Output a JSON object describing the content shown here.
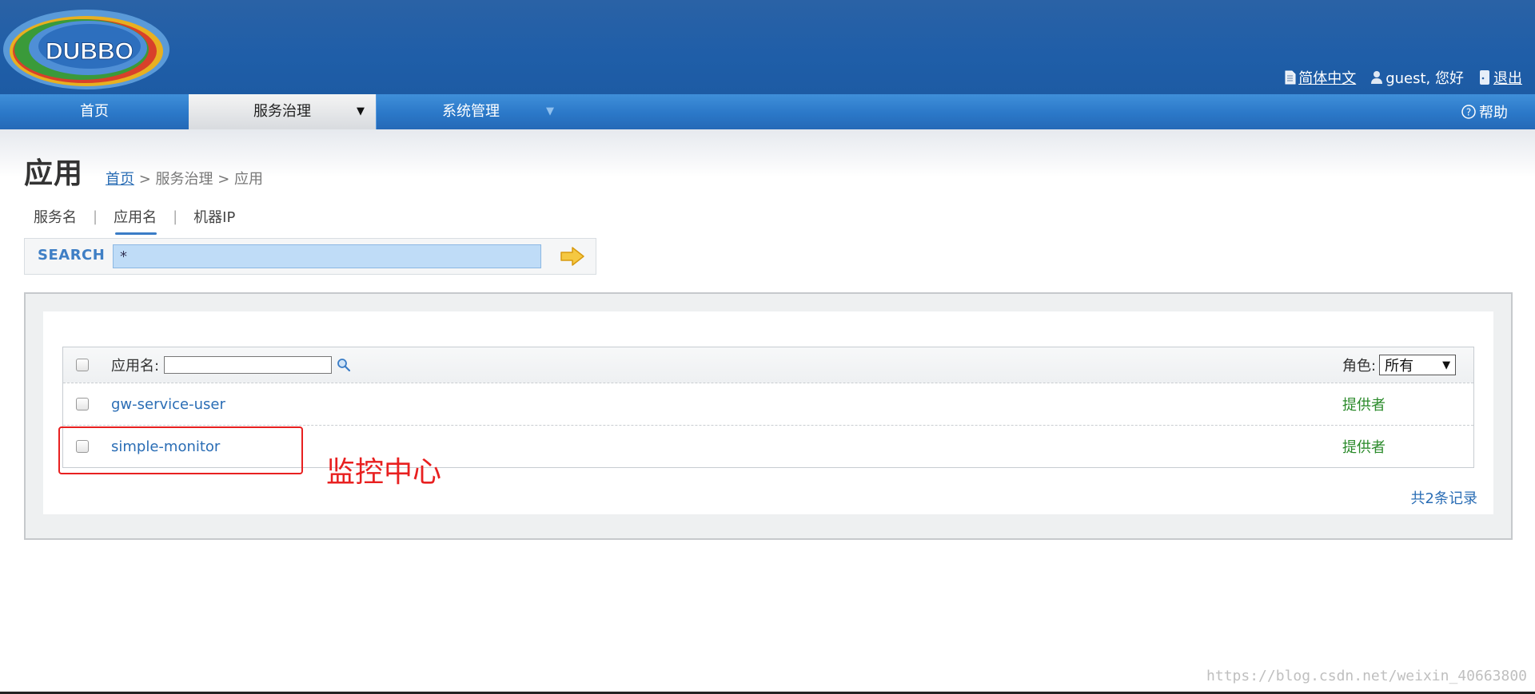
{
  "header": {
    "logo_text": "DUBBO",
    "lang_link": "简体中文",
    "user_greeting": "guest, 您好",
    "logout_link": "退出"
  },
  "nav": {
    "items": [
      {
        "label": "首页"
      },
      {
        "label": "服务治理",
        "has_dropdown": true,
        "active": true
      },
      {
        "label": "系统管理",
        "has_dropdown": true
      }
    ],
    "help_label": "帮助"
  },
  "page": {
    "title": "应用",
    "breadcrumb": {
      "home": "首页",
      "rest": " > 服务治理 > 应用"
    }
  },
  "search_tabs": {
    "items": [
      {
        "label": "服务名"
      },
      {
        "label": "应用名",
        "active": true
      },
      {
        "label": "机器IP"
      }
    ],
    "separator": "|"
  },
  "search": {
    "label": "SEARCH",
    "value": "*"
  },
  "table": {
    "header": {
      "name_label": "应用名:",
      "role_label": "角色:",
      "role_selected": "所有"
    },
    "rows": [
      {
        "name": "gw-service-user",
        "role": "提供者"
      },
      {
        "name": "simple-monitor",
        "role": "提供者"
      }
    ],
    "total": "共2条记录"
  },
  "annotation": {
    "note": "监控中心"
  },
  "watermark": "https://blog.csdn.net/weixin_40663800",
  "colors": {
    "header_bg": "#1f5ea8",
    "nav_bg": "#2b78c8",
    "link": "#2a6db5",
    "role_green": "#2a8a2a",
    "annotation_red": "#e82020"
  }
}
